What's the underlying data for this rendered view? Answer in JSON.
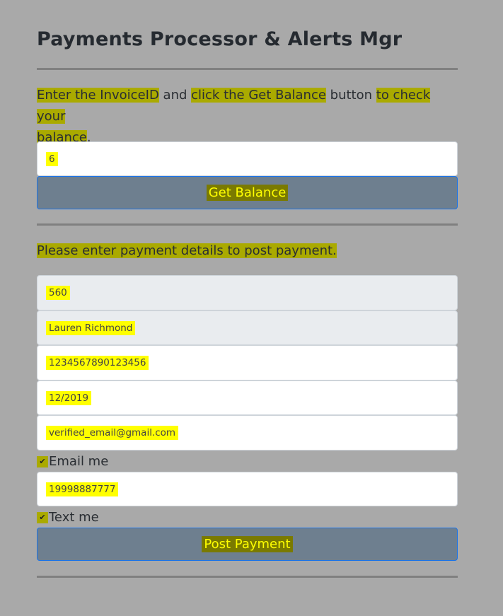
{
  "title": "Payments Processor & Alerts Mgr",
  "balance": {
    "instruction_parts": [
      "Enter the InvoiceID",
      " and ",
      "click the Get Balance",
      " button ",
      "to check your",
      " ",
      "balance",
      "."
    ],
    "invoice_id": "6",
    "button_label": "Get Balance"
  },
  "payment": {
    "instruction": "Please enter payment details to post payment.",
    "fields": [
      "560",
      "Lauren Richmond",
      "1234567890123456",
      "12/2019",
      "verified_email@gmail.com"
    ],
    "email_me_label": "Email me",
    "email_me_checked": true,
    "phone": "19998887777",
    "text_me_label": "Text me",
    "text_me_checked": true,
    "button_label": "Post Payment"
  },
  "colors": {
    "background": "#a9a9a9",
    "button": "#6e7f8f",
    "highlight": "#ffff00"
  }
}
